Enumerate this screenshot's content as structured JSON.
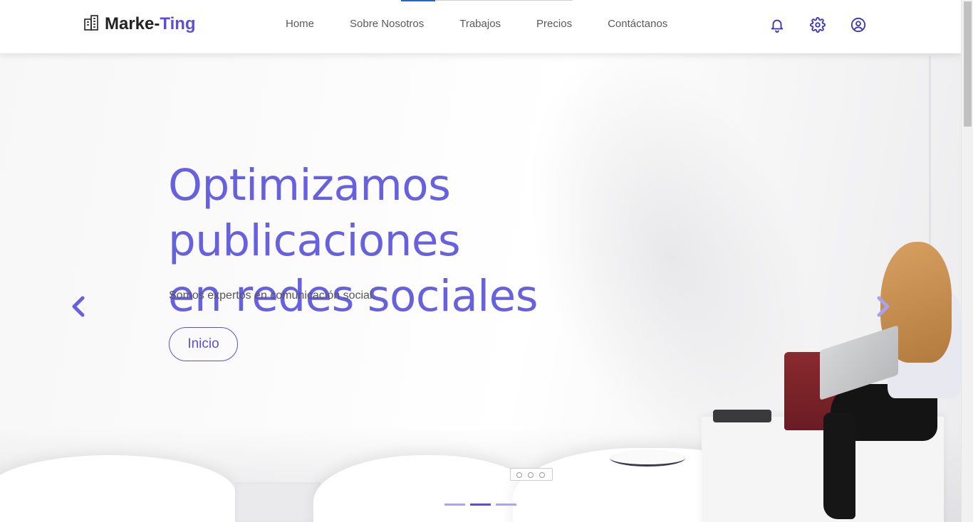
{
  "brand": {
    "name_main": "Marke-",
    "name_accent": "Ting",
    "icon": "building-icon",
    "accent_color": "#5b4fd6"
  },
  "nav": {
    "links": [
      {
        "label": "Home"
      },
      {
        "label": "Sobre Nosotros"
      },
      {
        "label": "Trabajos"
      },
      {
        "label": "Precios"
      },
      {
        "label": "Contáctanos"
      }
    ],
    "icons": [
      "bell-icon",
      "gear-icon",
      "user-circle-icon"
    ]
  },
  "hero": {
    "headline_line1": "Optimizamos publicaciones",
    "headline_line2": "en redes sociales",
    "subtext": "Somos expertos en comunicación social.",
    "cta_label": "Inicio",
    "headline_color": "#6761e0",
    "prev_icon": "chevron-left-icon",
    "next_icon": "chevron-right-icon",
    "slides_total": 3,
    "active_slide": 2
  }
}
